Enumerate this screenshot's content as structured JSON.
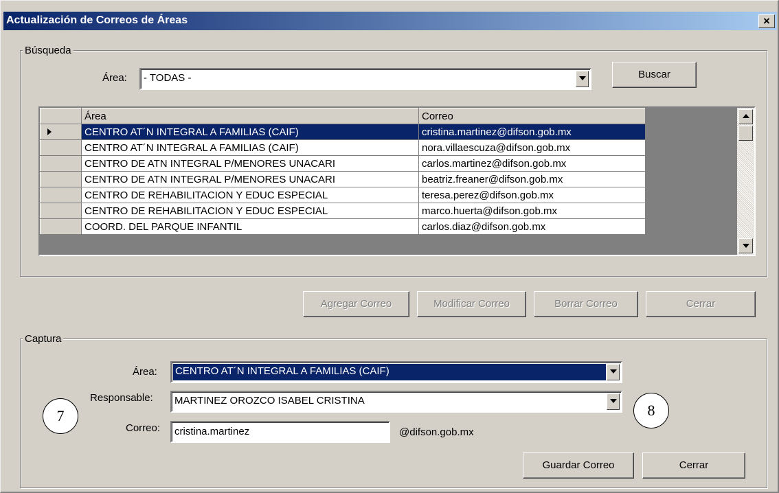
{
  "window": {
    "title": "Actualización de Correos de Áreas",
    "close": "×"
  },
  "busqueda": {
    "group_label": "Búsqueda",
    "area_label": "Área:",
    "area_value": "- TODAS -",
    "buscar": "Buscar"
  },
  "grid": {
    "columns": [
      "Área",
      "Correo"
    ],
    "rows": [
      {
        "area": "CENTRO AT´N INTEGRAL A FAMILIAS (CAIF)",
        "correo": "cristina.martinez@difson.gob.mx"
      },
      {
        "area": "CENTRO AT´N INTEGRAL A FAMILIAS (CAIF)",
        "correo": "nora.villaescuza@difson.gob.mx"
      },
      {
        "area": "CENTRO DE ATN INTEGRAL P/MENORES UNACARI",
        "correo": "carlos.martinez@difson.gob.mx"
      },
      {
        "area": "CENTRO DE ATN INTEGRAL P/MENORES UNACARI",
        "correo": "beatriz.freaner@difson.gob.mx"
      },
      {
        "area": "CENTRO DE REHABILITACION Y EDUC ESPECIAL",
        "correo": "teresa.perez@difson.gob.mx"
      },
      {
        "area": "CENTRO DE REHABILITACION Y EDUC ESPECIAL",
        "correo": "marco.huerta@difson.gob.mx"
      },
      {
        "area": "COORD. DEL PARQUE INFANTIL",
        "correo": "carlos.diaz@difson.gob.mx"
      }
    ]
  },
  "actions": {
    "agregar": "Agregar Correo",
    "modificar": "Modificar Correo",
    "borrar": "Borrar Correo",
    "cerrar": "Cerrar"
  },
  "captura": {
    "group_label": "Captura",
    "area_label": "Área:",
    "area_value": "CENTRO AT´N INTEGRAL A FAMILIAS (CAIF)",
    "responsable_label": "Responsable:",
    "responsable_value": "MARTINEZ OROZCO ISABEL CRISTINA",
    "correo_label": "Correo:",
    "correo_value": "cristina.martinez",
    "domain": "@difson.gob.mx",
    "guardar": "Guardar Correo",
    "cerrar": "Cerrar"
  },
  "callouts": {
    "left": "7",
    "right": "8"
  }
}
